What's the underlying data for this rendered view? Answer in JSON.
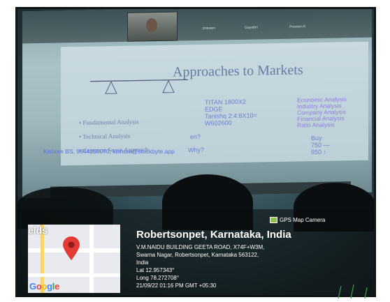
{
  "slide": {
    "title": "Approaches to Markets",
    "bullets": [
      "Fundamental Analysis",
      "Technical Analysis",
      "Common Sense Approach"
    ],
    "middle": [
      "TITAN 1800X2",
      "EDGE",
      "Tanishq 2:4:8X10=",
      "W602600",
      "en?",
      "Why?"
    ],
    "right": [
      "Economic Analysis",
      "Industry Analysis",
      "Company Analysis",
      "Financial Analysis",
      "Ratio Analysis"
    ],
    "buy": [
      "Buy",
      "750 —",
      "850 ↑"
    ],
    "contact": "Kishore BS, 9844250070, kishore@stockbyte.app"
  },
  "meeting": {
    "participant_tabs": [
      "praveen",
      "Gayathri",
      "Praveen K"
    ]
  },
  "gps": {
    "app_label": "GPS Map Camera",
    "map_fragment": "elds",
    "map_provider": "Google",
    "city": "Robertsonpet, Karnataka, India",
    "address_lines": [
      "V.M.NAIDU BUILDING GEETA ROAD, X74F+W3M,",
      "Swarna Nagar, Robertsonpet, Karnataka 563122,",
      "India",
      "Lat 12.957343°",
      "Long 78.272708°",
      "21/09/22 01:16 PM GMT +05:30"
    ]
  },
  "colors": {
    "slide_blue": "#5e6ee6",
    "pin_red": "#e53935",
    "gps_badge": "#8bc34a"
  }
}
